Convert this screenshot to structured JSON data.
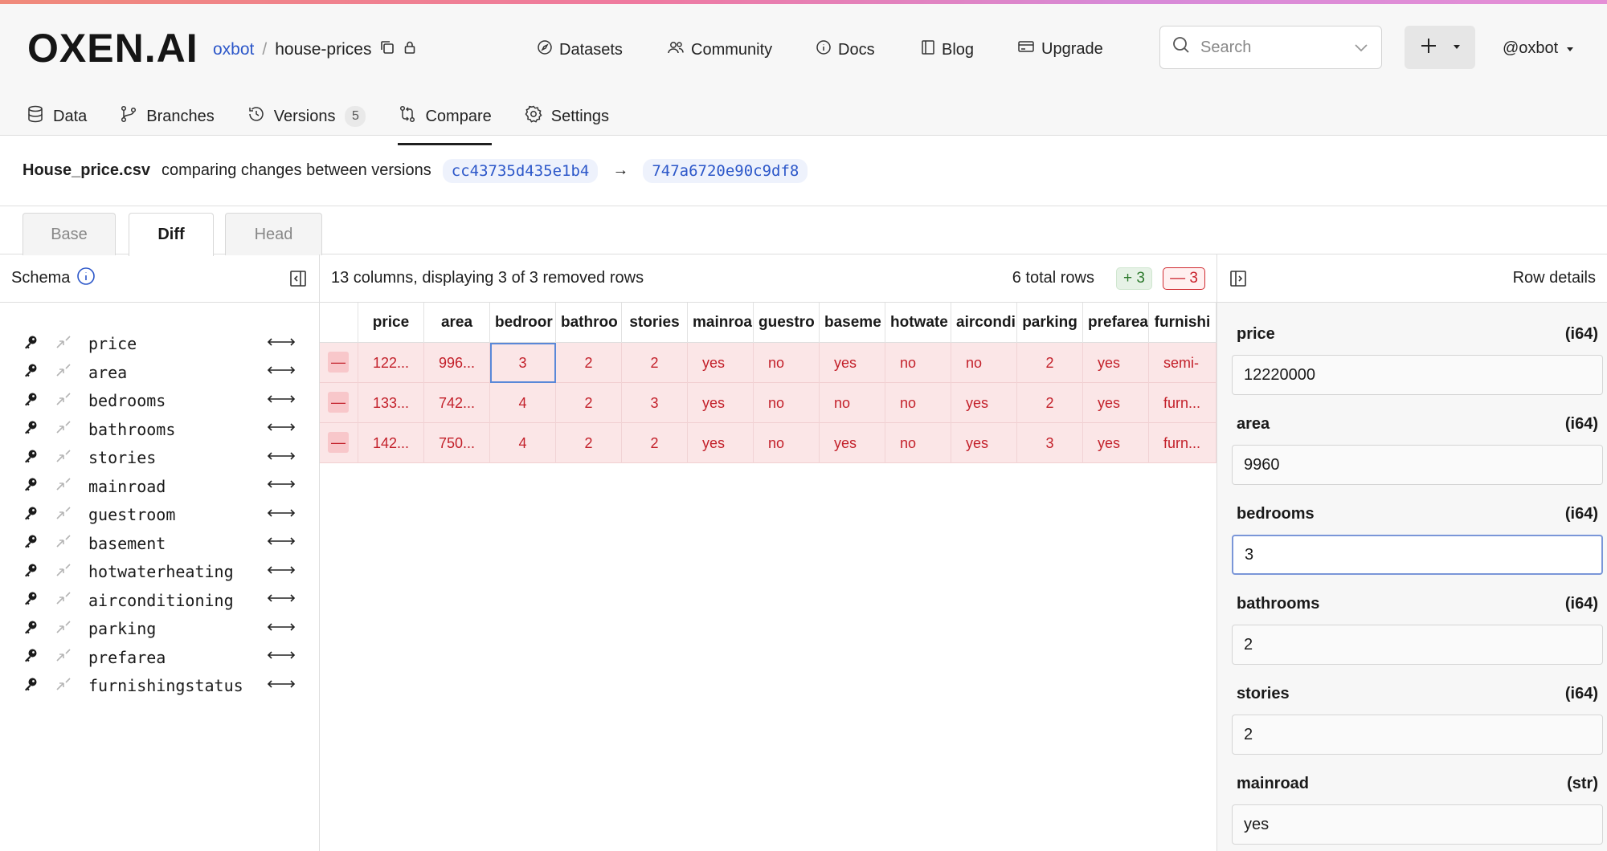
{
  "brand": {
    "logo": "OXEN.AI",
    "accent": "#2c57c9"
  },
  "repo": {
    "owner": "oxbot",
    "separator": "/",
    "name": "house-prices"
  },
  "topnav": [
    {
      "label": "Datasets",
      "icon": "compass-icon"
    },
    {
      "label": "Community",
      "icon": "users-icon"
    },
    {
      "label": "Docs",
      "icon": "info-icon"
    },
    {
      "label": "Blog",
      "icon": "book-icon"
    },
    {
      "label": "Upgrade",
      "icon": "card-icon"
    }
  ],
  "search": {
    "placeholder": "Search"
  },
  "user": {
    "handle": "@oxbot"
  },
  "tabs": [
    {
      "label": "Data",
      "icon": "database-icon"
    },
    {
      "label": "Branches",
      "icon": "branch-icon"
    },
    {
      "label": "Versions",
      "icon": "history-icon",
      "count": "5"
    },
    {
      "label": "Compare",
      "icon": "compare-icon",
      "active": true
    },
    {
      "label": "Settings",
      "icon": "gear-icon"
    }
  ],
  "compare": {
    "file": "House_price.csv",
    "text": "comparing changes between versions",
    "base_sha": "cc43735d435e1b4",
    "arrow": "→",
    "head_sha": "747a6720e90c9df8"
  },
  "view_tabs": [
    {
      "label": "Base"
    },
    {
      "label": "Diff",
      "active": true
    },
    {
      "label": "Head"
    }
  ],
  "schema": {
    "title": "Schema",
    "columns": [
      "price",
      "area",
      "bedrooms",
      "bathrooms",
      "stories",
      "mainroad",
      "guestroom",
      "basement",
      "hotwaterheating",
      "airconditioning",
      "parking",
      "prefarea",
      "furnishingstatus"
    ]
  },
  "table": {
    "summary": "13 columns, displaying 3 of 3 removed rows",
    "total_rows": "6 total rows",
    "added_badge": "+ 3",
    "removed_badge": "— 3",
    "headers": [
      "price",
      "area",
      "bedroor",
      "bathroo",
      "stories",
      "mainroa",
      "guestro",
      "baseme",
      "hotwate",
      "aircondi",
      "parking",
      "prefarea",
      "furnishi"
    ],
    "rows": [
      [
        "122...",
        "996...",
        "3",
        "2",
        "2",
        "yes",
        "no",
        "yes",
        "no",
        "no",
        "2",
        "yes",
        "semi-"
      ],
      [
        "133...",
        "742...",
        "4",
        "2",
        "3",
        "yes",
        "no",
        "no",
        "no",
        "yes",
        "2",
        "yes",
        "furn..."
      ],
      [
        "142...",
        "750...",
        "4",
        "2",
        "2",
        "yes",
        "no",
        "yes",
        "no",
        "yes",
        "3",
        "yes",
        "furn..."
      ]
    ],
    "removed_marker": "—"
  },
  "details": {
    "title": "Row details",
    "fields": [
      {
        "name": "price",
        "type": "(i64)",
        "value": "12220000"
      },
      {
        "name": "area",
        "type": "(i64)",
        "value": "9960"
      },
      {
        "name": "bedrooms",
        "type": "(i64)",
        "value": "3"
      },
      {
        "name": "bathrooms",
        "type": "(i64)",
        "value": "2"
      },
      {
        "name": "stories",
        "type": "(i64)",
        "value": "2"
      },
      {
        "name": "mainroad",
        "type": "(str)",
        "value": "yes"
      }
    ]
  }
}
